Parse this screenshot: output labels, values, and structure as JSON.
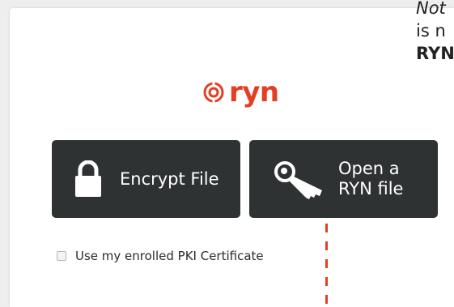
{
  "logo": {
    "text": "ryn",
    "color": "#e43e23",
    "icon": "ring-target-icon"
  },
  "actions": {
    "encrypt": {
      "label": "Encrypt File",
      "icon": "lock-icon"
    },
    "open": {
      "label_line1": "Open a",
      "label_line2": "RYN file",
      "icon": "key-icon"
    }
  },
  "options": {
    "pki_checkbox_label": "Use my enrolled PKI Certificate",
    "pki_checked": false
  },
  "side_note": {
    "line1": "Not",
    "line2": "is n",
    "line3": "RYN"
  },
  "colors": {
    "tile_background": "#2f3233",
    "accent": "#e43e23",
    "card_background": "#ffffff"
  }
}
